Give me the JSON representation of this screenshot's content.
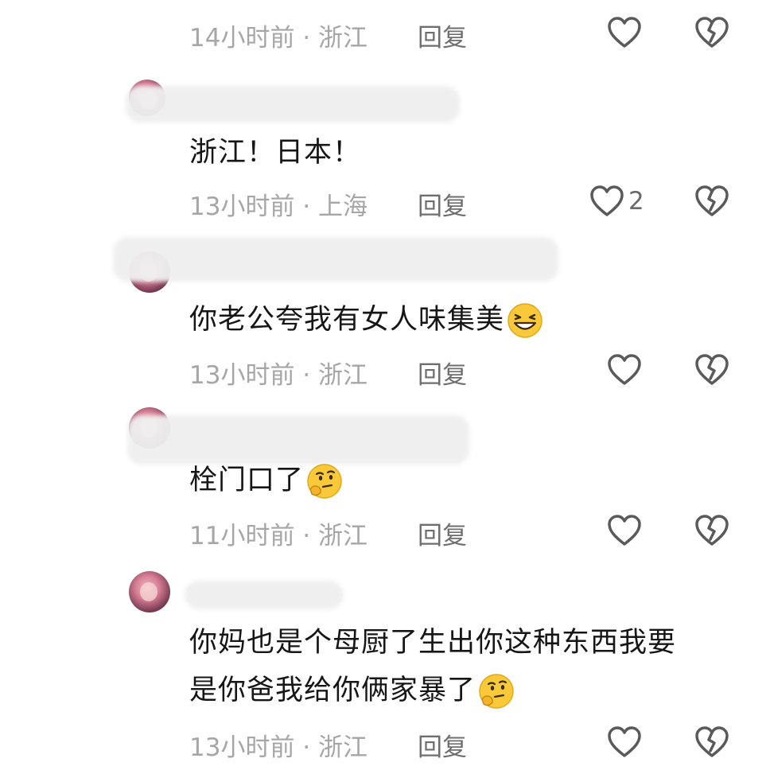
{
  "comments": [
    {
      "username": "",
      "text": "",
      "time": "14小时前",
      "location": "浙江",
      "reply_label": "回复",
      "likes": ""
    },
    {
      "username": "",
      "text": "浙江！日本！",
      "time": "13小时前",
      "location": "上海",
      "reply_label": "回复",
      "likes": "2"
    },
    {
      "username": "",
      "text": "你老公夸我有女人味集美",
      "emoji": "grinning-face-emoji",
      "time": "13小时前",
      "location": "浙江",
      "reply_label": "回复",
      "likes": ""
    },
    {
      "username": "",
      "text": "栓门口了",
      "emoji": "thinking-face-emoji",
      "time": "11小时前",
      "location": "浙江",
      "reply_label": "回复",
      "likes": ""
    },
    {
      "username": "",
      "text_line1": "你妈也是个母厨了生出你这种东西我要",
      "text_line2": "是你爸我给你俩家暴了",
      "emoji": "thinking-face-emoji",
      "time": "13小时前",
      "location": "浙江",
      "reply_label": "回复",
      "likes": ""
    }
  ],
  "separator": "·",
  "icons": {
    "like": "heart-outline-icon",
    "dislike": "broken-heart-icon"
  },
  "colors": {
    "text": "#161616",
    "meta": "#a6a6a6",
    "reply": "#6e6e6e",
    "icon": "#5a5a5a"
  }
}
